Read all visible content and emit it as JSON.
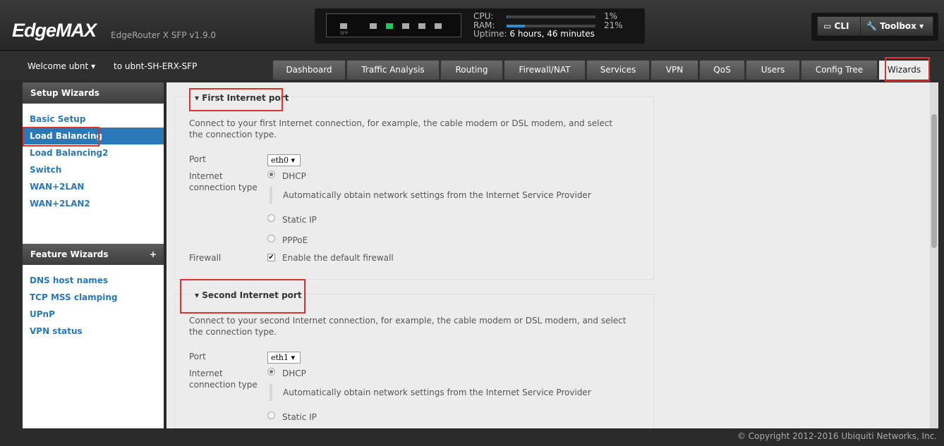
{
  "header": {
    "logo": "EdgeMAX",
    "version": "EdgeRouter X SFP v1.9.0",
    "sfp_label": "SFP",
    "cpu_label": "CPU:",
    "ram_label": "RAM:",
    "cpu_pct": "1%",
    "ram_pct": "21%",
    "cpu_value": 1,
    "ram_value": 21,
    "uptime_label": "Uptime:",
    "uptime": "6 hours, 46 minutes",
    "cli": "CLI",
    "toolbox": "Toolbox",
    "active_port_color": "#22c55e",
    "accent": "#2b78b8"
  },
  "nav": {
    "welcome": "Welcome ubnt",
    "router": "to ubnt-SH-ERX-SFP",
    "tabs": [
      "Dashboard",
      "Traffic Analysis",
      "Routing",
      "Firewall/NAT",
      "Services",
      "VPN",
      "QoS",
      "Users",
      "Config Tree",
      "Wizards"
    ],
    "active_tab": "Wizards"
  },
  "sidebar": {
    "setup_title": "Setup Wizards",
    "setup_items": [
      "Basic Setup",
      "Load Balancing",
      "Load Balancing2",
      "Switch",
      "WAN+2LAN",
      "WAN+2LAN2"
    ],
    "selected": "Load Balancing",
    "feature_title": "Feature Wizards",
    "feature_add": "+",
    "feature_items": [
      "DNS host names",
      "TCP MSS clamping",
      "UPnP",
      "VPN status"
    ]
  },
  "first": {
    "title": "First Internet port",
    "desc": "Connect to your first Internet connection, for example, the cable modem or DSL modem, and select the connection type.",
    "port_label": "Port",
    "port": "eth0",
    "type_label": "Internet connection type",
    "dhcp": "DHCP",
    "dhcp_desc": "Automatically obtain network settings from the Internet Service Provider",
    "static": "Static IP",
    "pppoe": "PPPoE",
    "firewall_label": "Firewall",
    "firewall_opt": "Enable the default firewall",
    "firewall_checked": true
  },
  "second": {
    "title": "Second Internet port",
    "desc": "Connect to your second Internet connection, for example, the cable modem or DSL modem, and select the connection type.",
    "port_label": "Port",
    "port": "eth1",
    "type_label": "Internet connection type",
    "dhcp": "DHCP",
    "dhcp_desc": "Automatically obtain network settings from the Internet Service Provider",
    "static": "Static IP"
  },
  "footer": {
    "copyright": "© Copyright 2012-2016 Ubiquiti Networks, Inc."
  }
}
